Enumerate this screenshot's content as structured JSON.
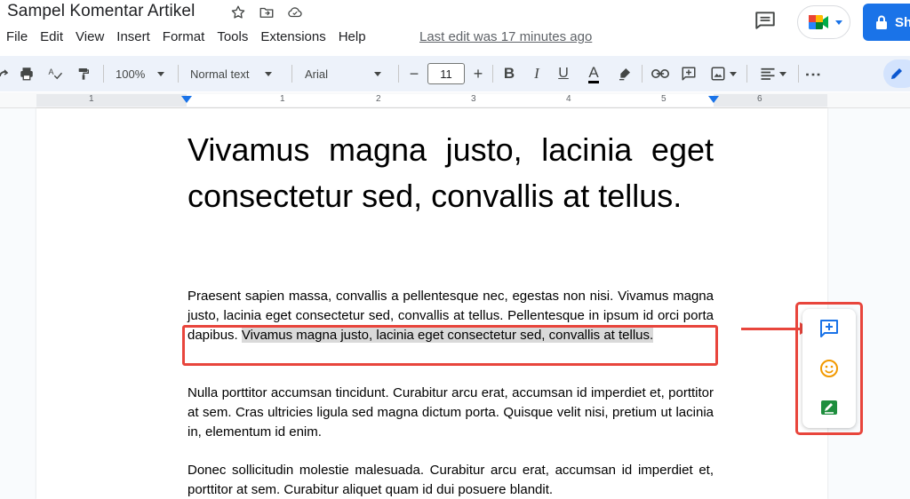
{
  "titlebar": {
    "doc_title": "Sampel Komentar Artikel",
    "share_label": "Sh",
    "last_edit": "Last edit was 17 minutes ago"
  },
  "menu": {
    "items": [
      "File",
      "Edit",
      "View",
      "Insert",
      "Format",
      "Tools",
      "Extensions",
      "Help"
    ]
  },
  "toolbar": {
    "zoom": "100%",
    "style": "Normal text",
    "font": "Arial",
    "font_size": "11",
    "minus": "−",
    "plus": "+",
    "bold": "B",
    "italic": "I",
    "underline": "U",
    "text_color": "A",
    "more": "⋮"
  },
  "ruler": {
    "numbers": [
      "1",
      "1",
      "2",
      "3",
      "4",
      "5",
      "6"
    ]
  },
  "document": {
    "heading": "Vivamus magna justo, lacinia eget consectetur sed, convallis at tellus.",
    "p1_before": "Praesent sapien massa, convallis a pellentesque nec, egestas non nisi. Vivamus magna justo, lacinia eget consectetur sed, convallis at tellus. Pellentesque in ipsum id orci porta dapibus. ",
    "p1_selected": "Vivamus magna justo, lacinia eget consectetur sed, convallis at tellus.",
    "p2": "Nulla porttitor accumsan tincidunt. Curabitur arcu erat, accumsan id imperdiet et, porttitor at sem. Cras ultricies ligula sed magna dictum porta. Quisque velit nisi, pretium ut lacinia in, elementum id enim.",
    "p3": "Donec sollicitudin molestie malesuada. Curabitur arcu erat, accumsan id imperdiet et, porttitor at sem. Curabitur aliquet quam id dui posuere blandit."
  },
  "side_panel": {
    "buttons": [
      "add-comment-icon",
      "emoji-reaction-icon",
      "suggest-edits-icon"
    ]
  },
  "colors": {
    "accent": "#1a73e8",
    "annotation": "#e8453c",
    "selection": "#d9d9d9",
    "toolbar_bg": "#edf2fa"
  }
}
